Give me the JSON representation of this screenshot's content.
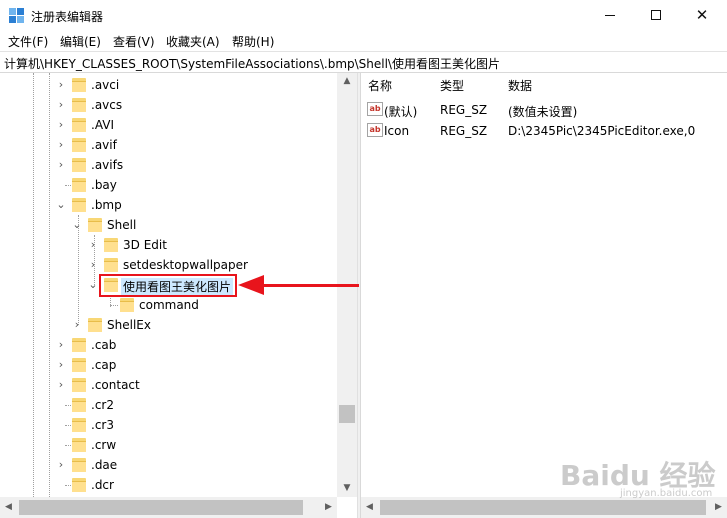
{
  "window": {
    "title": "注册表编辑器",
    "minimize_glyph": "—",
    "close_glyph": "✕"
  },
  "menu": [
    "文件(F)",
    "编辑(E)",
    "查看(V)",
    "收藏夹(A)",
    "帮助(H)"
  ],
  "address": "计算机\\HKEY_CLASSES_ROOT\\SystemFileAssociations\\.bmp\\Shell\\使用看图王美化图片",
  "tree": [
    {
      "label": ".avci",
      "expander": "›"
    },
    {
      "label": ".avcs",
      "expander": "›"
    },
    {
      "label": ".AVI",
      "expander": "›"
    },
    {
      "label": ".avif",
      "expander": "›"
    },
    {
      "label": ".avifs",
      "expander": "›"
    },
    {
      "label": ".bay",
      "expander": ""
    },
    {
      "label": ".bmp",
      "expander": "⌄"
    },
    {
      "label": "Shell",
      "expander": "⌄"
    },
    {
      "label": "3D Edit",
      "expander": "›"
    },
    {
      "label": "setdesktopwallpaper",
      "expander": "›"
    },
    {
      "label": "使用看图王美化图片",
      "expander": "⌄"
    },
    {
      "label": "command",
      "expander": ""
    },
    {
      "label": "ShellEx",
      "expander": "›"
    },
    {
      "label": ".cab",
      "expander": "›"
    },
    {
      "label": ".cap",
      "expander": "›"
    },
    {
      "label": ".contact",
      "expander": "›"
    },
    {
      "label": ".cr2",
      "expander": ""
    },
    {
      "label": ".cr3",
      "expander": ""
    },
    {
      "label": ".crw",
      "expander": ""
    },
    {
      "label": ".dae",
      "expander": "›"
    },
    {
      "label": ".dcr",
      "expander": ""
    }
  ],
  "values_header": {
    "name": "名称",
    "type": "类型",
    "data": "数据"
  },
  "values": [
    {
      "icon": "ab",
      "name": "(默认)",
      "type": "REG_SZ",
      "data": "(数值未设置)"
    },
    {
      "icon": "ab",
      "name": "Icon",
      "type": "REG_SZ",
      "data": "D:\\2345Pic\\2345PicEditor.exe,0"
    }
  ],
  "watermark": {
    "main": "Baidu 经验",
    "sub": "jingyan.baidu.com"
  },
  "colors": {
    "annotation": "#e8141c",
    "selection": "#cce8ff",
    "folder": "#ffe08f"
  }
}
